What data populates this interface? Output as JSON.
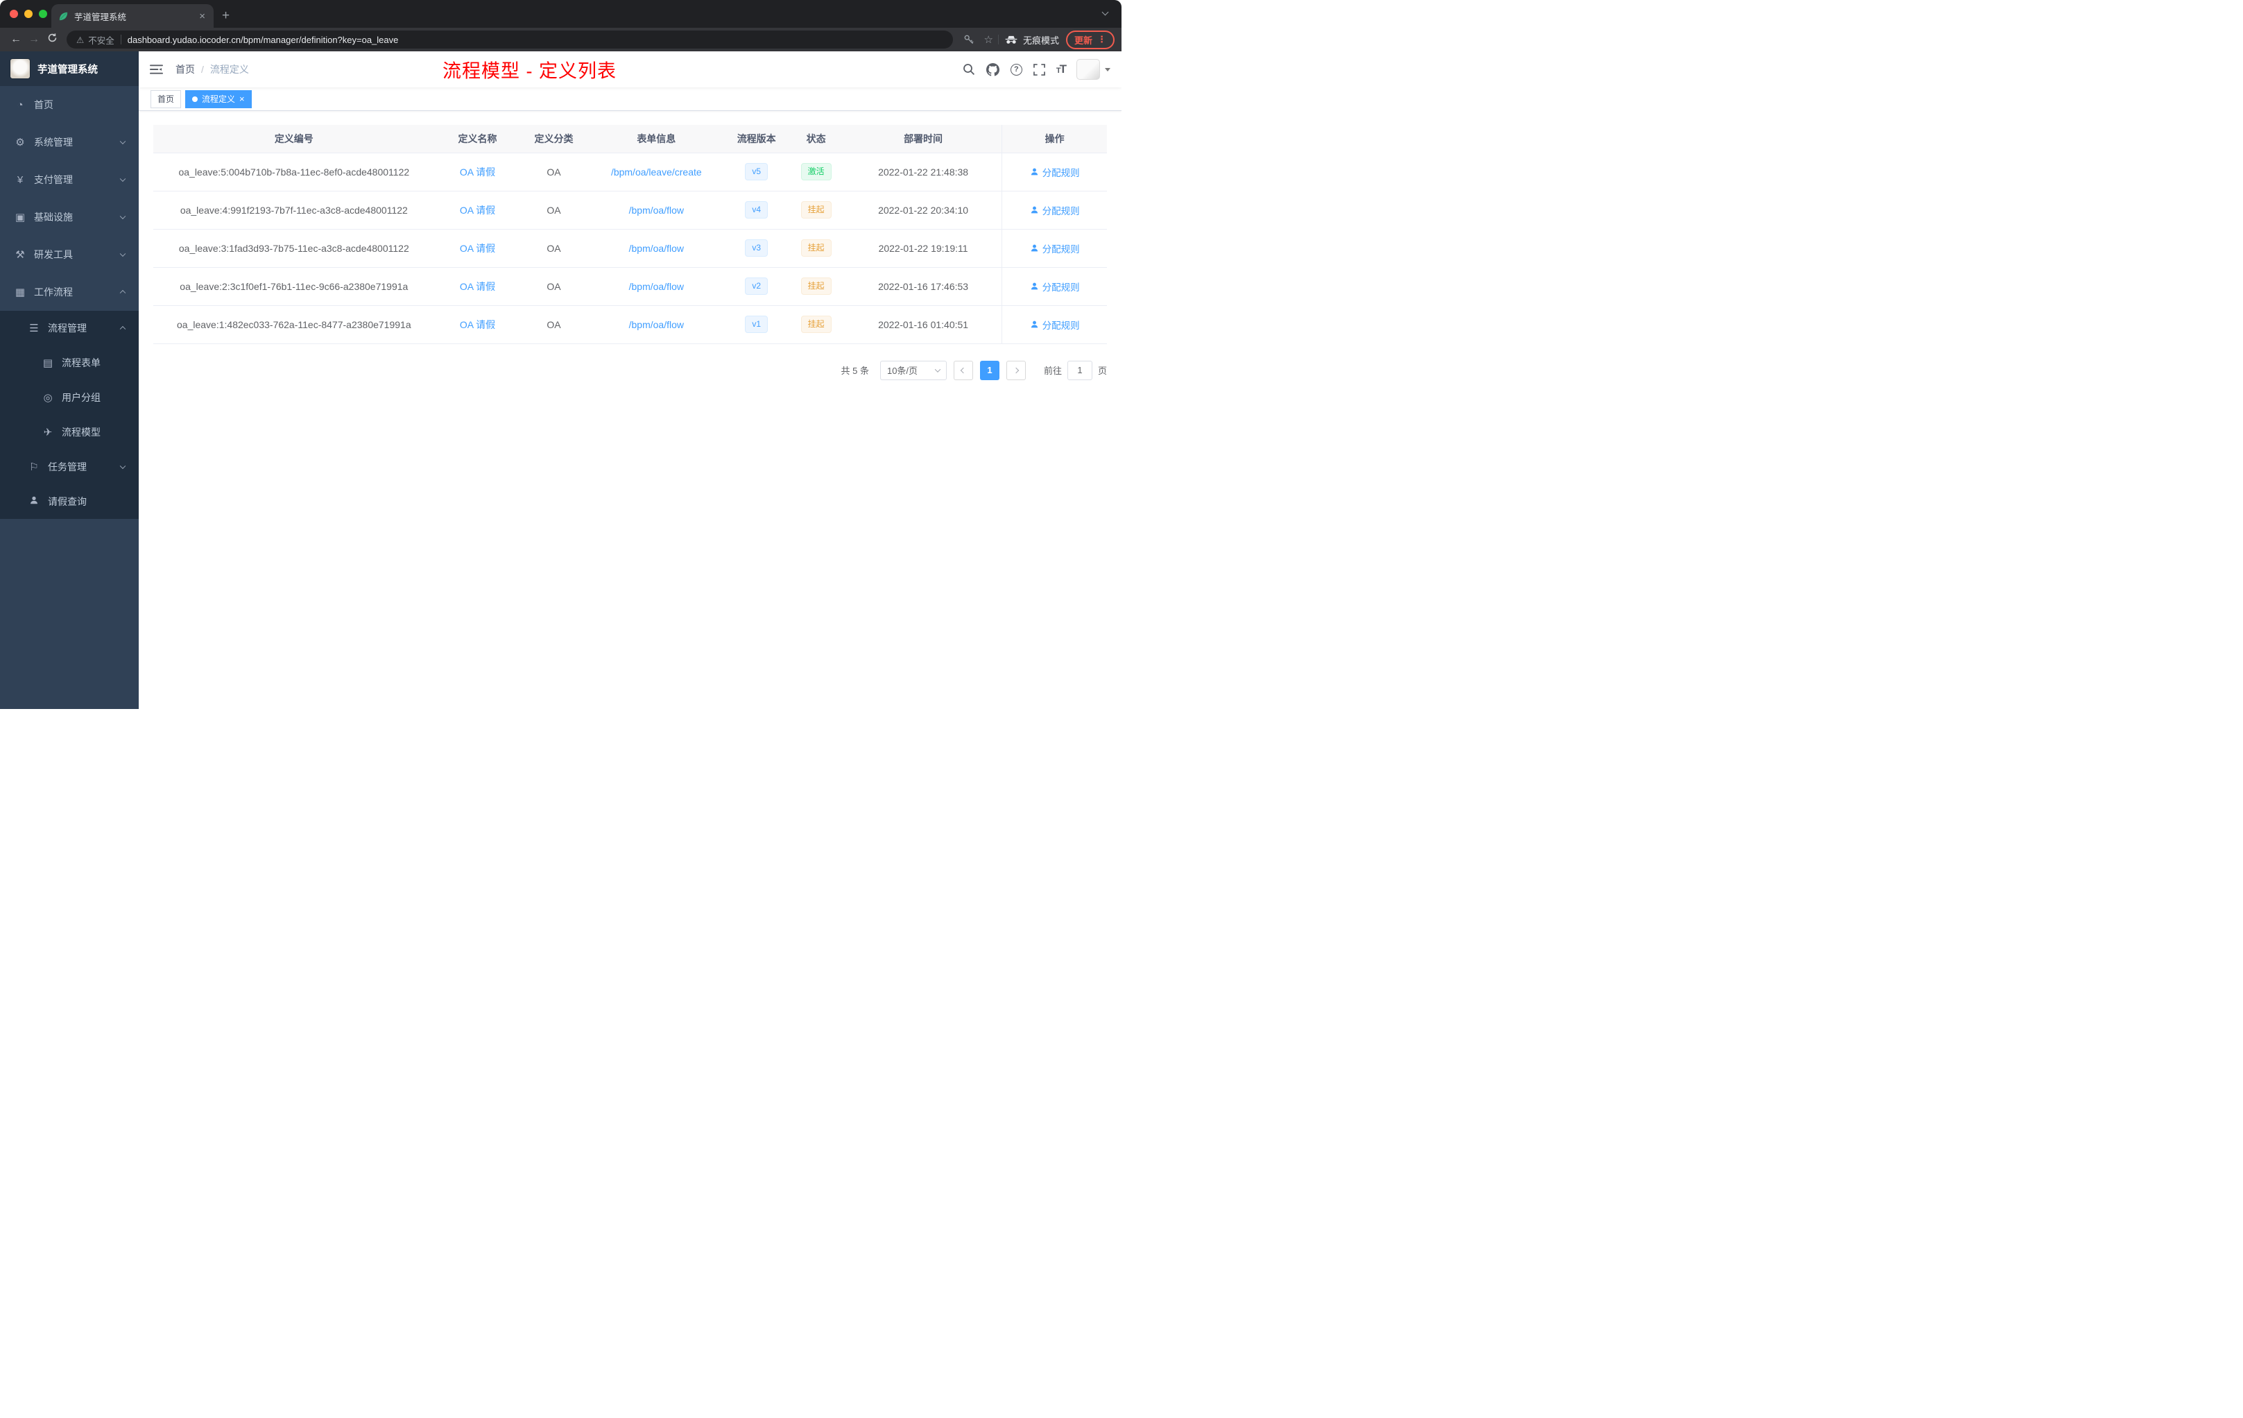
{
  "colors": {
    "accent": "#409eff",
    "annotation_red": "#fe0000",
    "status_active": "#13ce66",
    "status_suspended": "#e6a23c",
    "sidebar_bg": "#304156",
    "submenu_bg": "#1f2d3d"
  },
  "browser": {
    "tab_title": "芋道管理系统",
    "security_label": "不安全",
    "url": "dashboard.yudao.iocoder.cn/bpm/manager/definition?key=oa_leave",
    "incognito_label": "无痕模式",
    "update_label": "更新"
  },
  "icons": {
    "plus": "+",
    "close": "×",
    "back": "←",
    "forward": "→",
    "warning": "⚠",
    "star": "☆",
    "kebab": "⋮",
    "question": "?",
    "font_size": "TT"
  },
  "sidebar": {
    "logo_title": "芋道管理系统",
    "menu": [
      {
        "label": "首页",
        "icon": "◔"
      },
      {
        "label": "系统管理",
        "icon": "⚙"
      },
      {
        "label": "支付管理",
        "icon": "¥"
      },
      {
        "label": "基础设施",
        "icon": "▣"
      },
      {
        "label": "研发工具",
        "icon": "⚒"
      },
      {
        "label": "工作流程",
        "icon": "▦"
      },
      {
        "label": "流程管理",
        "icon": "☰"
      },
      {
        "label": "流程表单",
        "icon": "▤"
      },
      {
        "label": "用户分组",
        "icon": "◎"
      },
      {
        "label": "流程模型",
        "icon": "✈"
      },
      {
        "label": "任务管理",
        "icon": "⚐"
      },
      {
        "label": "请假查询",
        "icon": ""
      }
    ]
  },
  "header": {
    "breadcrumb": {
      "home": "首页",
      "separator": "/",
      "current": "流程定义"
    },
    "annotation": "流程模型 - 定义列表"
  },
  "tags": [
    {
      "label": "首页"
    },
    {
      "label": "流程定义"
    }
  ],
  "table": {
    "columns": [
      "定义编号",
      "定义名称",
      "定义分类",
      "表单信息",
      "流程版本",
      "状态",
      "部署时间",
      "操作"
    ],
    "action_label": "分配规则",
    "rows": [
      {
        "id": "oa_leave:5:004b710b-7b8a-11ec-8ef0-acde48001122",
        "name": "OA 请假",
        "category": "OA",
        "form": "/bpm/oa/leave/create",
        "version": "v5",
        "status": "激活",
        "time": "2022-01-22 21:48:38"
      },
      {
        "id": "oa_leave:4:991f2193-7b7f-11ec-a3c8-acde48001122",
        "name": "OA 请假",
        "category": "OA",
        "form": "/bpm/oa/flow",
        "version": "v4",
        "status": "挂起",
        "time": "2022-01-22 20:34:10"
      },
      {
        "id": "oa_leave:3:1fad3d93-7b75-11ec-a3c8-acde48001122",
        "name": "OA 请假",
        "category": "OA",
        "form": "/bpm/oa/flow",
        "version": "v3",
        "status": "挂起",
        "time": "2022-01-22 19:19:11"
      },
      {
        "id": "oa_leave:2:3c1f0ef1-76b1-11ec-9c66-a2380e71991a",
        "name": "OA 请假",
        "category": "OA",
        "form": "/bpm/oa/flow",
        "version": "v2",
        "status": "挂起",
        "time": "2022-01-16 17:46:53"
      },
      {
        "id": "oa_leave:1:482ec033-762a-11ec-8477-a2380e71991a",
        "name": "OA 请假",
        "category": "OA",
        "form": "/bpm/oa/flow",
        "version": "v1",
        "status": "挂起",
        "time": "2022-01-16 01:40:51"
      }
    ]
  },
  "pagination": {
    "total": "共 5 条",
    "page_size": "10条/页",
    "page": "1",
    "goto_label": "前往",
    "goto_value": "1",
    "goto_unit": "页"
  }
}
